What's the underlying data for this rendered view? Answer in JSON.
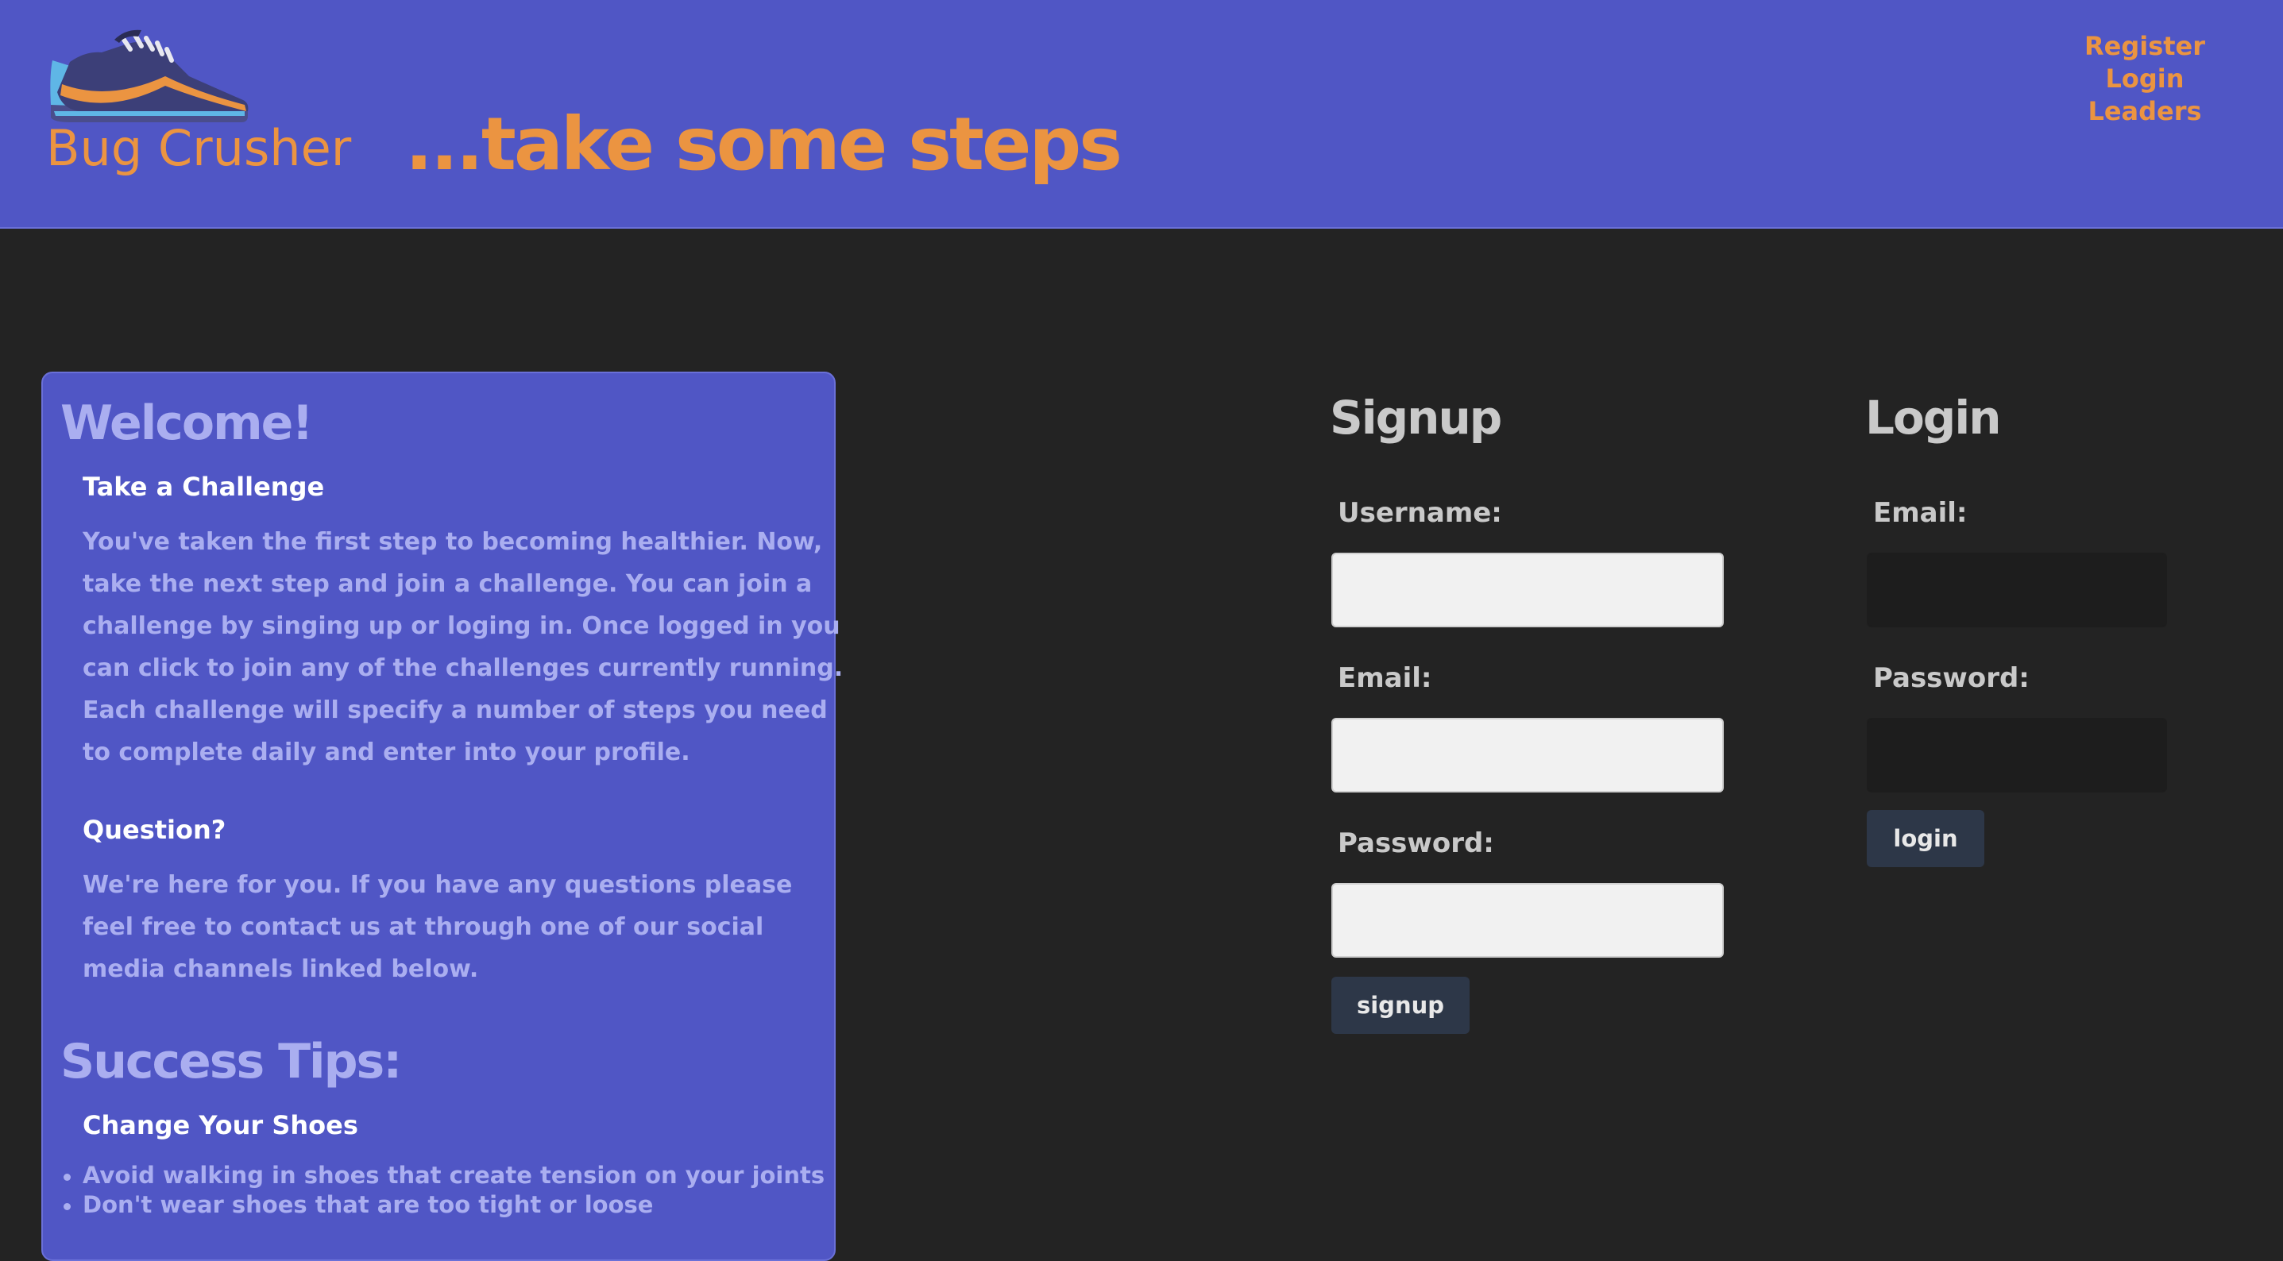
{
  "header": {
    "brand": "Bug Crusher",
    "tagline": "...take some steps",
    "logo_icon": "sneaker-icon",
    "nav": [
      "Register",
      "Login",
      "Leaders"
    ]
  },
  "welcome": {
    "title": "Welcome!",
    "challenge_heading": "Take a Challenge",
    "challenge_text_1": "You've taken the first step to becoming healthier. Now, take the next step and join a challenge. You can join a challenge by singing up or loging in. Once logged in you can click to join any of the challenges currently running.",
    "challenge_text_2": "Each challenge will specify a number of steps you need to complete daily and enter into your profile.",
    "question_heading": "Question?",
    "question_text": "We're here for you. If you have any questions please feel free to contact us at through one of our social media channels linked below.",
    "tips_title": "Success Tips:",
    "shoes_heading": "Change Your Shoes",
    "shoes_tips": [
      "Avoid walking in shoes that create tension on your joints",
      "Don't wear shoes that are too tight or loose"
    ]
  },
  "signup": {
    "title": "Signup",
    "username_label": "Username:",
    "username_value": "",
    "email_label": "Email:",
    "email_value": "",
    "password_label": "Password:",
    "password_value": "",
    "button": "signup"
  },
  "login": {
    "title": "Login",
    "email_label": "Email:",
    "email_value": "",
    "password_label": "Password:",
    "password_value": "",
    "button": "login"
  },
  "colors": {
    "header_bg": "#5056c5",
    "accent": "#eb9441",
    "page_bg": "#232323",
    "panel_text": "#aaaef0",
    "button_bg": "#2d3748"
  }
}
